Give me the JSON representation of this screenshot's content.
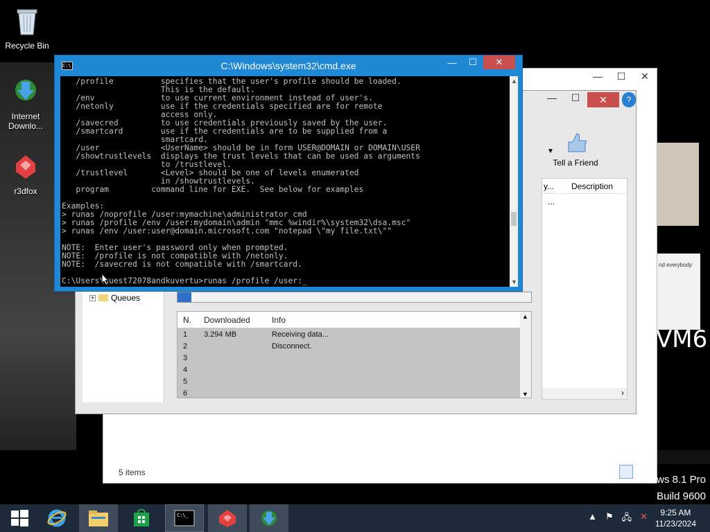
{
  "desktop": {
    "recycle_bin_label": "Recycle Bin",
    "idm_icon_label_1": "Internet",
    "idm_icon_label_2": "Downlo...",
    "r3dfox_label": "r3dfox"
  },
  "explorer": {
    "status_items": "5 items"
  },
  "idm": {
    "tell_friend": "Tell a Friend",
    "col_description": "Description",
    "col_y": "y...",
    "dots": "...",
    "tree_queues": "Queues",
    "progress_fraction": 0.04,
    "table": {
      "headers": [
        "N.",
        "Downloaded",
        "Info"
      ],
      "rows": [
        [
          "1",
          "3.294 MB",
          "Receiving data..."
        ],
        [
          "2",
          "",
          "Disconnect."
        ],
        [
          "3",
          "",
          ""
        ],
        [
          "4",
          "",
          ""
        ],
        [
          "5",
          "",
          ""
        ],
        [
          "6",
          "",
          ""
        ]
      ]
    }
  },
  "cmd": {
    "title": "C:\\Windows\\system32\\cmd.exe",
    "lines": [
      "   /profile          specifies that the user's profile should be loaded.",
      "                     This is the default.",
      "   /env              to use current environment instead of user's.",
      "   /netonly          use if the credentials specified are for remote",
      "                     access only.",
      "   /savecred         to use credentials previously saved by the user.",
      "   /smartcard        use if the credentials are to be supplied from a",
      "                     smartcard.",
      "   /user             <UserName> should be in form USER@DOMAIN or DOMAIN\\USER",
      "   /showtrustlevels  displays the trust levels that can be used as arguments",
      "                     to /trustlevel.",
      "   /trustlevel       <Level> should be one of levels enumerated",
      "                     in /showtrustlevels.",
      "   program         command line for EXE.  See below for examples",
      "",
      "Examples:",
      "> runas /noprofile /user:mymachine\\administrator cmd",
      "> runas /profile /env /user:mydomain\\admin \"mmc %windir%\\system32\\dsa.msc\"",
      "> runas /env /user:user@domain.microsoft.com \"notepad \\\"my file.txt\\\"\"",
      "",
      "NOTE:  Enter user's password only when prompted.",
      "NOTE:  /profile is not compatible with /netonly.",
      "NOTE:  /savecred is not compatible with /smartcard.",
      "",
      "C:\\Users\\guest72078andkuvertu>runas /profile /user:_"
    ]
  },
  "watermark": {
    "line1": "ows 8.1 Pro",
    "line2": "Build 9600"
  },
  "overlay_text": {
    "vm6": "VM6",
    "small_note": "nd everybody"
  },
  "taskbar": {
    "time": "9:25 AM",
    "date": "11/23/2024"
  },
  "colors": {
    "cmd_frame": "#1e88d4",
    "close_red": "#c94f4f",
    "taskbar": "#1c2a3a"
  }
}
